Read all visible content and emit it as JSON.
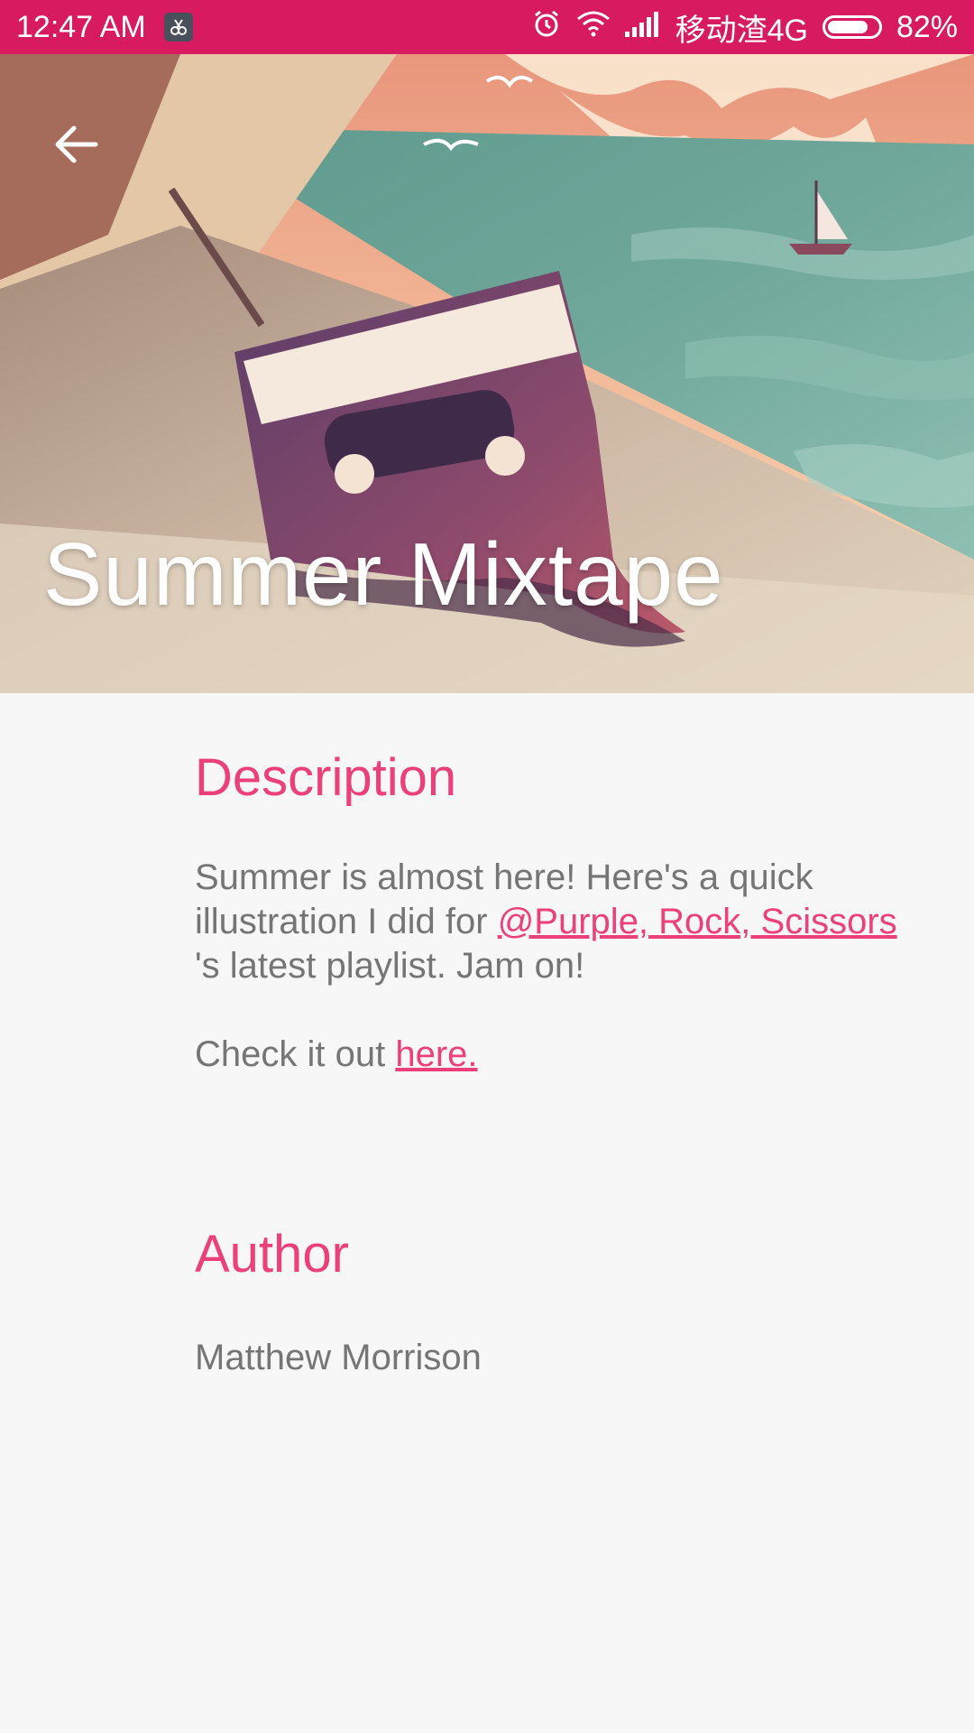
{
  "status_bar": {
    "time": "12:47 AM",
    "carrier": "移动渣4G",
    "battery_percent": "82%",
    "battery_level": 0.82,
    "icons": [
      "screenshot-icon",
      "alarm-icon",
      "wifi-icon",
      "signal-icon",
      "battery-icon"
    ]
  },
  "header": {
    "title": "Summer Mixtape",
    "back_icon": "arrow-back-icon"
  },
  "description": {
    "heading": "Description",
    "text_before_link": "Summer is almost here! Here's a quick illustration I did for ",
    "link_text": "@Purple, Rock, Scissors",
    "text_after_link": "'s latest playlist. Jam on!",
    "check_prefix": "Check it out ",
    "check_link": "here."
  },
  "author": {
    "heading": "Author",
    "name": "Matthew Morrison"
  },
  "colors": {
    "status_bar": "#d81b60",
    "accent": "#ec407a",
    "body_text": "#757575",
    "background": "#f7f7f7"
  }
}
